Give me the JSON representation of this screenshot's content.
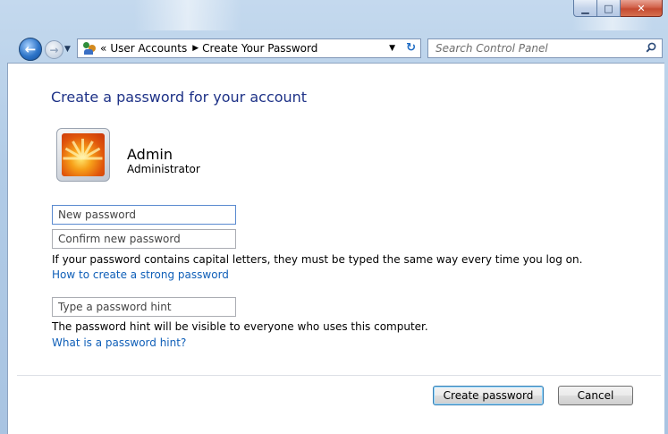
{
  "window": {
    "minimize_glyph": "▁",
    "maximize_glyph": "□",
    "close_glyph": "✕"
  },
  "navbar": {
    "back_glyph": "←",
    "forward_glyph": "→",
    "recent_glyph": "▼",
    "breadcrumb_overflow": "«",
    "breadcrumb": [
      "User Accounts",
      "Create Your Password"
    ],
    "breadcrumb_sep": "▶",
    "dropdown_glyph": "▼",
    "refresh_glyph": "↻",
    "search_placeholder": "Search Control Panel"
  },
  "main": {
    "heading": "Create a password for your account",
    "user": {
      "name": "Admin",
      "role": "Administrator"
    },
    "fields": {
      "new_password_placeholder": "New password",
      "confirm_password_placeholder": "Confirm new password",
      "hint_placeholder": "Type a password hint"
    },
    "caps_note": "If your password contains capital letters, they must be typed the same way every time you log on.",
    "strong_password_link": "How to create a strong password",
    "hint_note": "The password hint will be visible to everyone who uses this computer.",
    "hint_link": "What is a password hint?"
  },
  "buttons": {
    "create": "Create password",
    "cancel": "Cancel"
  },
  "colors": {
    "heading": "#1e3287",
    "link": "#0f5fb8",
    "frame": "#b1cbe6"
  }
}
